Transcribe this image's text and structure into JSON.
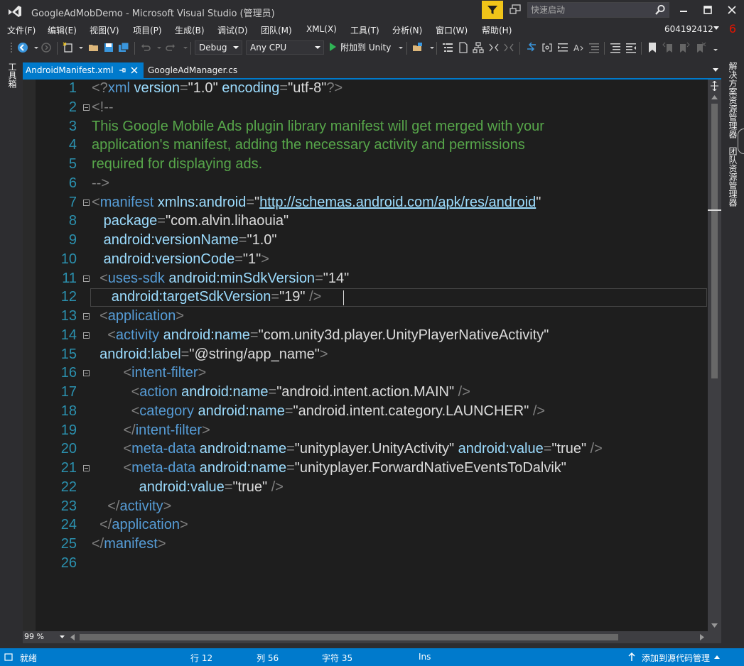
{
  "window": {
    "title": "GoogleAdMobDemo - Microsoft Visual Studio (管理员)",
    "quick_launch_placeholder": "快速启动",
    "notification_count": "6",
    "account": "604192412"
  },
  "menu": [
    "文件(F)",
    "编辑(E)",
    "视图(V)",
    "项目(P)",
    "生成(B)",
    "调试(D)",
    "团队(M)",
    "XML(X)",
    "工具(T)",
    "分析(N)",
    "窗口(W)",
    "帮助(H)"
  ],
  "toolbar": {
    "configuration": "Debug",
    "platform": "Any CPU",
    "attach_label": "附加到 Unity"
  },
  "side_panels": {
    "toolbox": "工具箱",
    "solution_explorer": "解决方案资源管理器",
    "team_explorer": "团队资源管理器"
  },
  "tabs": [
    {
      "label": "AndroidManifest.xml",
      "active": true
    },
    {
      "label": "GoogleAdManager.cs",
      "active": false
    }
  ],
  "editor": {
    "zoom": "99 %",
    "current_line": 12,
    "lines": [
      {
        "n": "1",
        "fold": false,
        "segs": [
          [
            "p",
            "<?"
          ],
          [
            "t",
            "xml"
          ],
          [
            "a",
            " version"
          ],
          [
            "p",
            "="
          ],
          [
            "w",
            "\""
          ],
          [
            "w",
            "1.0"
          ],
          [
            "w",
            "\""
          ],
          [
            "a",
            " encoding"
          ],
          [
            "p",
            "="
          ],
          [
            "w",
            "\""
          ],
          [
            "w",
            "utf-8"
          ],
          [
            "w",
            "\""
          ],
          [
            "p",
            "?>"
          ]
        ]
      },
      {
        "n": "2",
        "fold": true,
        "segs": [
          [
            "p",
            "<!--"
          ]
        ]
      },
      {
        "n": "3",
        "fold": false,
        "segs": [
          [
            "c",
            "This Google Mobile Ads plugin library manifest will get merged with your"
          ]
        ]
      },
      {
        "n": "4",
        "fold": false,
        "segs": [
          [
            "c",
            "application's manifest, adding the necessary activity and permissions"
          ]
        ]
      },
      {
        "n": "5",
        "fold": false,
        "segs": [
          [
            "c",
            "required for displaying ads."
          ]
        ]
      },
      {
        "n": "6",
        "fold": false,
        "segs": [
          [
            "p",
            "-->"
          ]
        ]
      },
      {
        "n": "7",
        "fold": true,
        "segs": [
          [
            "p",
            "<"
          ],
          [
            "t",
            "manifest"
          ],
          [
            "a",
            " xmlns:android"
          ],
          [
            "p",
            "="
          ],
          [
            "w",
            "\""
          ],
          [
            "l",
            "http://schemas.android.com/apk/res/android"
          ],
          [
            "w",
            "\""
          ]
        ]
      },
      {
        "n": "8",
        "fold": false,
        "segs": [
          [
            "a",
            "   package"
          ],
          [
            "p",
            "="
          ],
          [
            "w",
            "\"com.alvin.lihaouia\""
          ]
        ]
      },
      {
        "n": "9",
        "fold": false,
        "segs": [
          [
            "a",
            "   android:versionName"
          ],
          [
            "p",
            "="
          ],
          [
            "w",
            "\"1.0\""
          ]
        ]
      },
      {
        "n": "10",
        "fold": false,
        "segs": [
          [
            "a",
            "   android:versionCode"
          ],
          [
            "p",
            "="
          ],
          [
            "w",
            "\"1\""
          ],
          [
            "p",
            ">"
          ]
        ]
      },
      {
        "n": "11",
        "fold": true,
        "segs": [
          [
            "p",
            "  <"
          ],
          [
            "t",
            "uses-sdk"
          ],
          [
            "a",
            " android:minSdkVersion"
          ],
          [
            "p",
            "="
          ],
          [
            "w",
            "\"14\""
          ]
        ]
      },
      {
        "n": "12",
        "fold": false,
        "segs": [
          [
            "a",
            "     android:targetSdkVersion"
          ],
          [
            "p",
            "="
          ],
          [
            "w",
            "\"19\""
          ],
          [
            "p",
            " />"
          ]
        ]
      },
      {
        "n": "13",
        "fold": true,
        "segs": [
          [
            "p",
            "  <"
          ],
          [
            "t",
            "application"
          ],
          [
            "p",
            ">"
          ]
        ]
      },
      {
        "n": "14",
        "fold": true,
        "segs": [
          [
            "p",
            "    <"
          ],
          [
            "t",
            "activity"
          ],
          [
            "a",
            " android:name"
          ],
          [
            "p",
            "="
          ],
          [
            "w",
            "\"com.unity3d.player.UnityPlayerNativeActivity\""
          ]
        ]
      },
      {
        "n": "15",
        "fold": false,
        "segs": [
          [
            "a",
            "  android:label"
          ],
          [
            "p",
            "="
          ],
          [
            "w",
            "\"@string/app_name\""
          ],
          [
            "p",
            ">"
          ]
        ]
      },
      {
        "n": "16",
        "fold": true,
        "segs": [
          [
            "p",
            "        <"
          ],
          [
            "t",
            "intent-filter"
          ],
          [
            "p",
            ">"
          ]
        ]
      },
      {
        "n": "17",
        "fold": false,
        "segs": [
          [
            "p",
            "          <"
          ],
          [
            "t",
            "action"
          ],
          [
            "a",
            " android:name"
          ],
          [
            "p",
            "="
          ],
          [
            "w",
            "\"android.intent.action.MAIN\""
          ],
          [
            "p",
            " />"
          ]
        ]
      },
      {
        "n": "18",
        "fold": false,
        "segs": [
          [
            "p",
            "          <"
          ],
          [
            "t",
            "category"
          ],
          [
            "a",
            " android:name"
          ],
          [
            "p",
            "="
          ],
          [
            "w",
            "\"android.intent.category.LAUNCHER\""
          ],
          [
            "p",
            " />"
          ]
        ]
      },
      {
        "n": "19",
        "fold": false,
        "segs": [
          [
            "p",
            "        </"
          ],
          [
            "t",
            "intent-filter"
          ],
          [
            "p",
            ">"
          ]
        ]
      },
      {
        "n": "20",
        "fold": false,
        "segs": [
          [
            "p",
            "        <"
          ],
          [
            "t",
            "meta-data"
          ],
          [
            "a",
            " android:name"
          ],
          [
            "p",
            "="
          ],
          [
            "w",
            "\"unityplayer.UnityActivity\""
          ],
          [
            "a",
            " android:value"
          ],
          [
            "p",
            "="
          ],
          [
            "w",
            "\"true\""
          ],
          [
            "p",
            " />"
          ]
        ]
      },
      {
        "n": "21",
        "fold": true,
        "segs": [
          [
            "p",
            "        <"
          ],
          [
            "t",
            "meta-data"
          ],
          [
            "a",
            " android:name"
          ],
          [
            "p",
            "="
          ],
          [
            "w",
            "\"unityplayer.ForwardNativeEventsToDalvik\""
          ]
        ]
      },
      {
        "n": "22",
        "fold": false,
        "segs": [
          [
            "a",
            "            android:value"
          ],
          [
            "p",
            "="
          ],
          [
            "w",
            "\"true\""
          ],
          [
            "p",
            " />"
          ]
        ]
      },
      {
        "n": "23",
        "fold": false,
        "segs": [
          [
            "p",
            "    </"
          ],
          [
            "t",
            "activity"
          ],
          [
            "p",
            ">"
          ]
        ]
      },
      {
        "n": "24",
        "fold": false,
        "segs": [
          [
            "p",
            "  </"
          ],
          [
            "t",
            "application"
          ],
          [
            "p",
            ">"
          ]
        ]
      },
      {
        "n": "25",
        "fold": false,
        "segs": [
          [
            "p",
            "</"
          ],
          [
            "t",
            "manifest"
          ],
          [
            "p",
            ">"
          ]
        ]
      },
      {
        "n": "26",
        "fold": false,
        "segs": []
      }
    ]
  },
  "status": {
    "state": "就绪",
    "line": "行 12",
    "col": "列 56",
    "char": "字符 35",
    "mode": "Ins",
    "source_control": "添加到源代码管理"
  },
  "colors": {
    "accent": "#007acc",
    "xml_tag": "#569cd6",
    "xml_attr": "#9cdcfe",
    "comment": "#57a64a",
    "line_number": "#2b91af",
    "notification": "#e51400"
  }
}
